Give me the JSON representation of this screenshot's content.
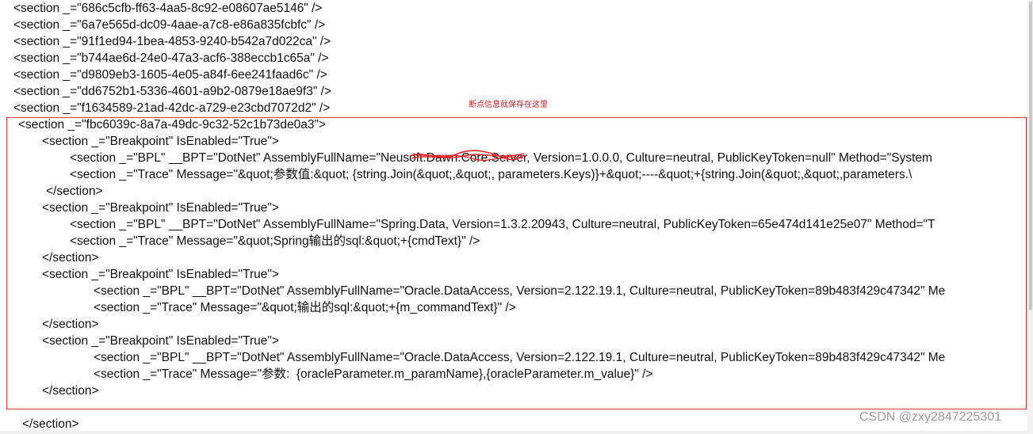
{
  "document": {
    "lines": [
      "<section _=\"686c5cfb-ff63-4aa5-8c92-e08607ae5146\" />",
      "<section _=\"6a7e565d-dc09-4aae-a7c8-e86a835fcbfc\" />",
      "<section _=\"91f1ed94-1bea-4853-9240-b542a7d022ca\" />",
      "<section _=\"b744ae6d-24e0-47a3-acf6-388eccb1c65a\" />",
      "<section _=\"d9809eb3-1605-4e05-a84f-6ee241faad6c\" />",
      "<section _=\"dd6752b1-5336-4601-a9b2-0879e18ae9f3\" />",
      "<section _=\"f1634589-21ad-42dc-a729-e23cbd7072d2\" />",
      "<section _=\"fbc6039c-8a7a-49dc-9c32-52c1b73de0a3\">",
      "<section _=\"Breakpoint\" IsEnabled=\"True\">",
      "<section _=\"BPL\" __BPT=\"DotNet\" AssemblyFullName=\"Neusoft.Dawn.Core.Server, Version=1.0.0.0, Culture=neutral, PublicKeyToken=null\" Method=\"System",
      "<section _=\"Trace\" Message=\"&quot;参数值:&quot; {string.Join(&quot;,&quot;, parameters.Keys)}+&quot;----&quot;+{string.Join(&quot;,&quot;,parameters.\\",
      "</section>",
      "<section _=\"Breakpoint\" IsEnabled=\"True\">",
      "<section _=\"BPL\" __BPT=\"DotNet\" AssemblyFullName=\"Spring.Data, Version=1.3.2.20943, Culture=neutral, PublicKeyToken=65e474d141e25e07\" Method=\"T",
      "<section _=\"Trace\" Message=\"&quot;Spring输出的sql:&quot;+{cmdText}\" />",
      "</section>",
      "<section _=\"Breakpoint\" IsEnabled=\"True\">",
      "<section _=\"BPL\" __BPT=\"DotNet\" AssemblyFullName=\"Oracle.DataAccess, Version=2.122.19.1, Culture=neutral, PublicKeyToken=89b483f429c47342\" Me",
      "<section _=\"Trace\" Message=\"&quot;输出的sql:&quot;+{m_commandText}\" />",
      "</section>",
      "<section _=\"Breakpoint\" IsEnabled=\"True\">",
      "<section _=\"BPL\" __BPT=\"DotNet\" AssemblyFullName=\"Oracle.DataAccess, Version=2.122.19.1, Culture=neutral, PublicKeyToken=89b483f429c47342\" Me",
      "<section _=\"Trace\" Message=\"参数:  {oracleParameter.m_paramName},{oracleParameter.m_value}\" />",
      "</section>",
      "",
      "</section>"
    ]
  },
  "annotation": {
    "text": "断点信息就保存在这里",
    "color": "#d02020"
  },
  "watermark": {
    "text": "CSDN @zxy2847225301"
  },
  "colors": {
    "highlight_border": "#d63c3c",
    "scribble": "#e02020"
  }
}
